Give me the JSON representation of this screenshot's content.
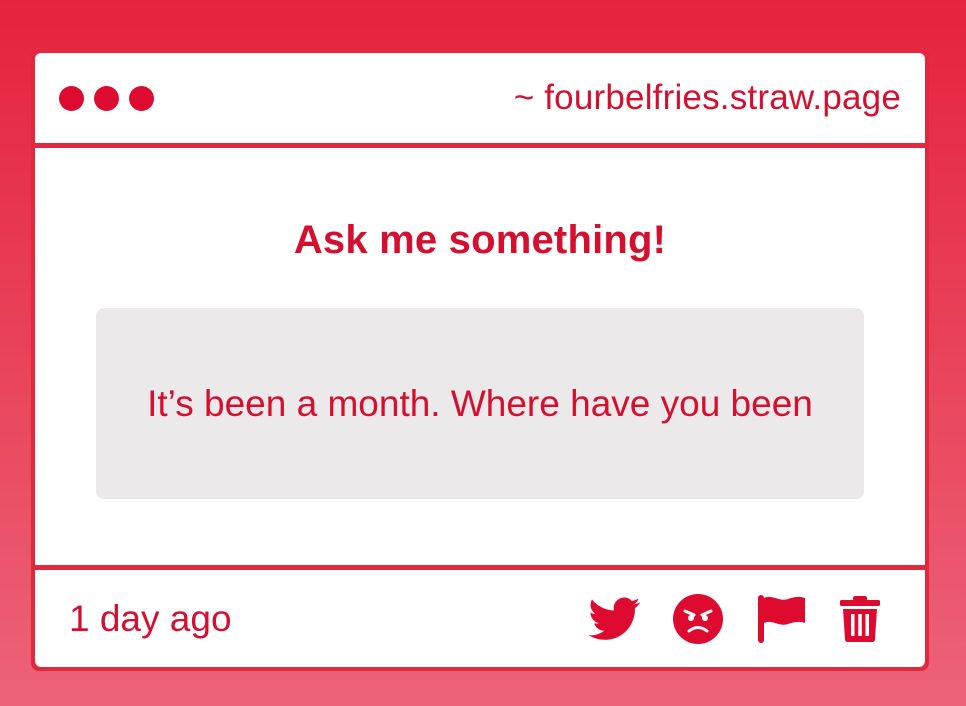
{
  "window": {
    "url": "~ fourbelfries.straw.page"
  },
  "main": {
    "heading": "Ask me something!",
    "question": "It’s been a month. Where have you been"
  },
  "footer": {
    "timestamp": "1 day ago",
    "actions": [
      {
        "icon": "twitter-icon"
      },
      {
        "icon": "angry-face-icon"
      },
      {
        "icon": "flag-icon"
      },
      {
        "icon": "trash-icon"
      }
    ]
  },
  "colors": {
    "accent": "#dc0b2f",
    "background_top": "#e5233e",
    "background_bottom": "#ec6377",
    "question_box": "#ebe9ea"
  }
}
